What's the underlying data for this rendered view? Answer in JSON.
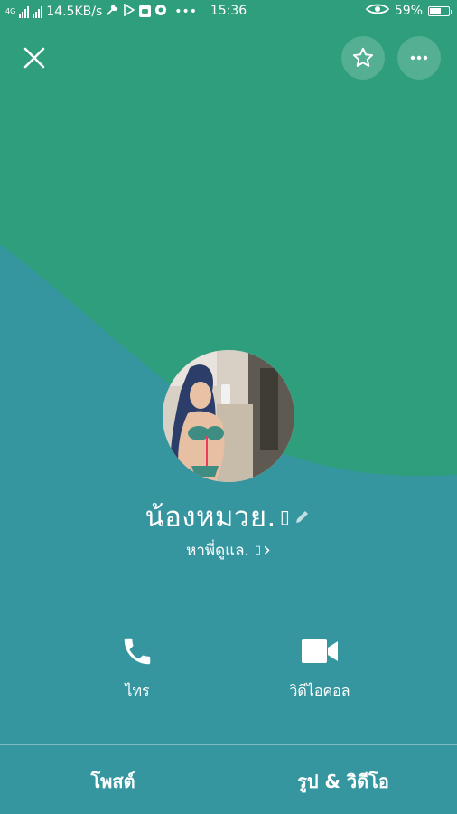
{
  "statusbar": {
    "network": "4G",
    "speed": "14.5KB/s",
    "dots": "•••",
    "time": "15:36",
    "battery": "59%",
    "battery_level": 0.59
  },
  "header": {
    "close_icon": "close-icon",
    "favorite_icon": "star-icon",
    "more_icon": "more-icon"
  },
  "profile": {
    "name": "น้องหมวย.",
    "name_emoji": "▯",
    "status_message": "หาพี่ดูแล.",
    "status_emoji": "▯",
    "status_chevron": "›"
  },
  "actions": {
    "call_label": "ไทร",
    "video_call_label": "วิดีไอคอล"
  },
  "tabs": {
    "posts_label": "โพสต์",
    "photos_videos_label": "รูป & วิดีโอ"
  },
  "colors": {
    "top_green": "#2f9e7c",
    "bottom_teal": "#3596a0",
    "text": "#ffffff"
  }
}
